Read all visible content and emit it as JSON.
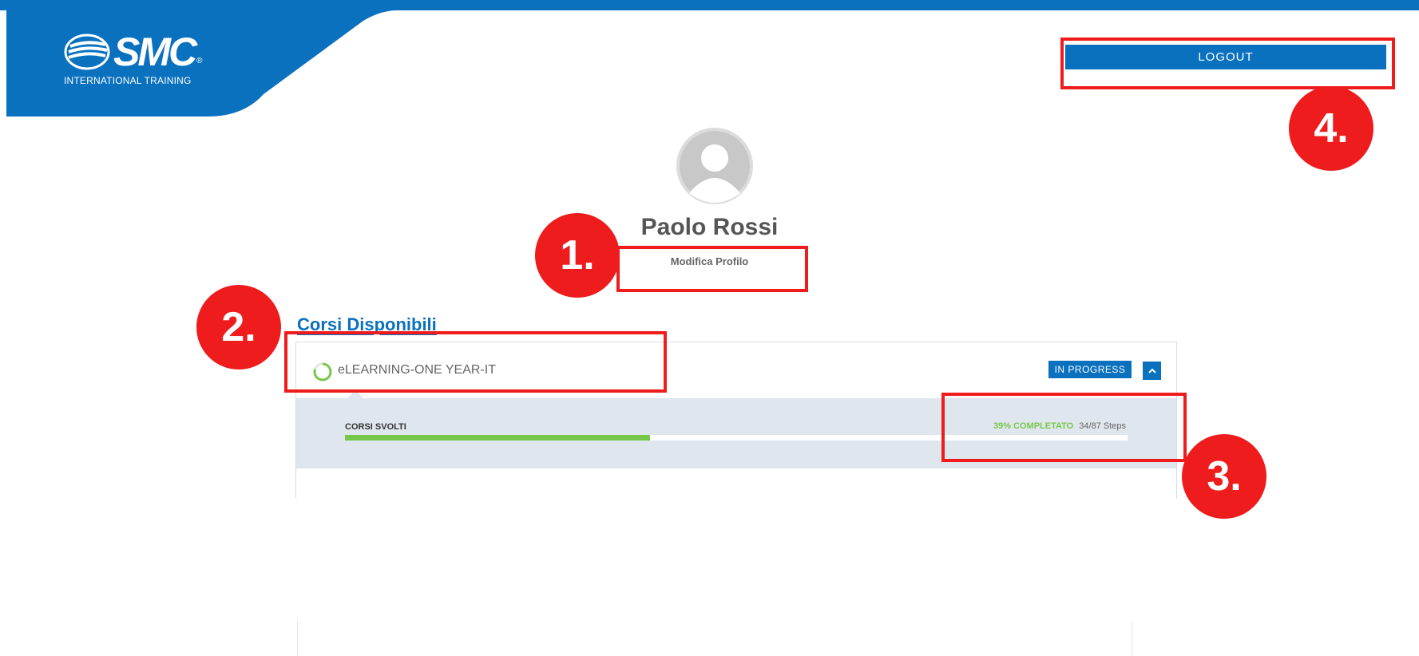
{
  "header": {
    "brand": "SMC",
    "brand_sub": "INTERNATIONAL TRAINING",
    "logout_label": "LOGOUT",
    "colors": {
      "primary": "#0a71bf",
      "progress": "#77c84a",
      "panel": "#e0e6ed",
      "annotation": "#ee1c1c"
    }
  },
  "profile": {
    "name": "Paolo Rossi",
    "edit_label": "Modifica Profilo",
    "avatar_icon": "user-avatar-icon"
  },
  "courses": {
    "title": "Corsi Disponibili",
    "items": [
      {
        "name": "eLEARNING-ONE YEAR-IT",
        "status": "IN PROGRESS",
        "toggle_icon": "chevron-up-icon",
        "progress_label": "CORSI SVOLTI",
        "percent_text": "39% COMPLETATO",
        "steps_text": "34/87 Steps",
        "progress_fraction": 0.39
      }
    ]
  },
  "annotations": [
    "1.",
    "2.",
    "3.",
    "4."
  ]
}
